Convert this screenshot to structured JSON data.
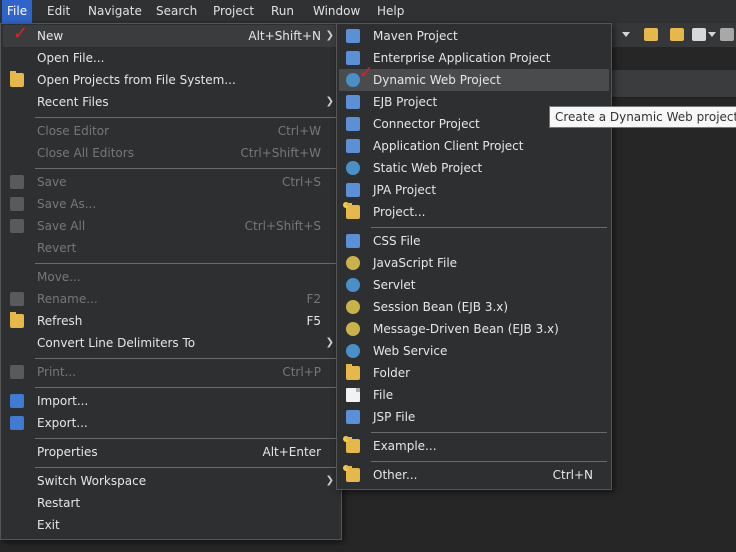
{
  "menubar": {
    "items": [
      "File",
      "Edit",
      "Navigate",
      "Search",
      "Project",
      "Run",
      "Window",
      "Help"
    ]
  },
  "file_menu": {
    "items": [
      {
        "label": "New",
        "shortcut": "Alt+Shift+N",
        "submenu": true,
        "highlighted": true
      },
      {
        "label": "Open File...",
        "icon": "open-file-icon"
      },
      {
        "label": "Open Projects from File System...",
        "icon": "folder-icon"
      },
      {
        "label": "Recent Files",
        "submenu": true
      },
      {
        "label": "Close Editor",
        "shortcut": "Ctrl+W",
        "disabled": true
      },
      {
        "label": "Close All Editors",
        "shortcut": "Ctrl+Shift+W",
        "disabled": true
      },
      {
        "label": "Save",
        "shortcut": "Ctrl+S",
        "disabled": true,
        "icon": "save-icon"
      },
      {
        "label": "Save As...",
        "disabled": true,
        "icon": "save-as-icon"
      },
      {
        "label": "Save All",
        "shortcut": "Ctrl+Shift+S",
        "disabled": true,
        "icon": "save-all-icon"
      },
      {
        "label": "Revert",
        "disabled": true
      },
      {
        "label": "Move...",
        "disabled": true
      },
      {
        "label": "Rename...",
        "shortcut": "F2",
        "disabled": true,
        "icon": "rename-icon"
      },
      {
        "label": "Refresh",
        "shortcut": "F5",
        "icon": "refresh-icon"
      },
      {
        "label": "Convert Line Delimiters To",
        "submenu": true
      },
      {
        "label": "Print...",
        "shortcut": "Ctrl+P",
        "disabled": true,
        "icon": "print-icon"
      },
      {
        "label": "Import...",
        "icon": "import-icon"
      },
      {
        "label": "Export...",
        "icon": "export-icon"
      },
      {
        "label": "Properties",
        "shortcut": "Alt+Enter"
      },
      {
        "label": "Switch Workspace",
        "submenu": true
      },
      {
        "label": "Restart"
      },
      {
        "label": "Exit"
      }
    ]
  },
  "new_menu": {
    "items": [
      {
        "label": "Maven Project",
        "icon": "maven-project-icon"
      },
      {
        "label": "Enterprise Application Project",
        "icon": "enterprise-application-icon"
      },
      {
        "label": "Dynamic Web Project",
        "icon": "dynamic-web-project-icon",
        "highlighted": true
      },
      {
        "label": "EJB Project",
        "icon": "ejb-project-icon"
      },
      {
        "label": "Connector Project",
        "icon": "connector-project-icon"
      },
      {
        "label": "Application Client Project",
        "icon": "application-client-icon"
      },
      {
        "label": "Static Web Project",
        "icon": "static-web-project-icon"
      },
      {
        "label": "JPA Project",
        "icon": "jpa-project-icon"
      },
      {
        "label": "Project...",
        "icon": "project-icon"
      },
      {
        "label": "CSS File",
        "icon": "css-file-icon"
      },
      {
        "label": "JavaScript File",
        "icon": "javascript-file-icon"
      },
      {
        "label": "Servlet",
        "icon": "servlet-icon"
      },
      {
        "label": "Session Bean (EJB 3.x)",
        "icon": "session-bean-icon"
      },
      {
        "label": "Message-Driven Bean (EJB 3.x)",
        "icon": "message-driven-bean-icon"
      },
      {
        "label": "Web Service",
        "icon": "web-service-icon"
      },
      {
        "label": "Folder",
        "icon": "folder-icon"
      },
      {
        "label": "File",
        "icon": "file-icon"
      },
      {
        "label": "JSP File",
        "icon": "jsp-file-icon"
      },
      {
        "label": "Example...",
        "icon": "example-icon"
      },
      {
        "label": "Other...",
        "shortcut": "Ctrl+N",
        "icon": "other-icon"
      }
    ]
  },
  "tooltip": {
    "text": "Create a Dynamic Web project"
  },
  "colors": {
    "menubar_active": "#2f65ca",
    "menu_background": "#2e2f31",
    "check_mark": "#e0202a",
    "disabled_text": "#777777"
  }
}
